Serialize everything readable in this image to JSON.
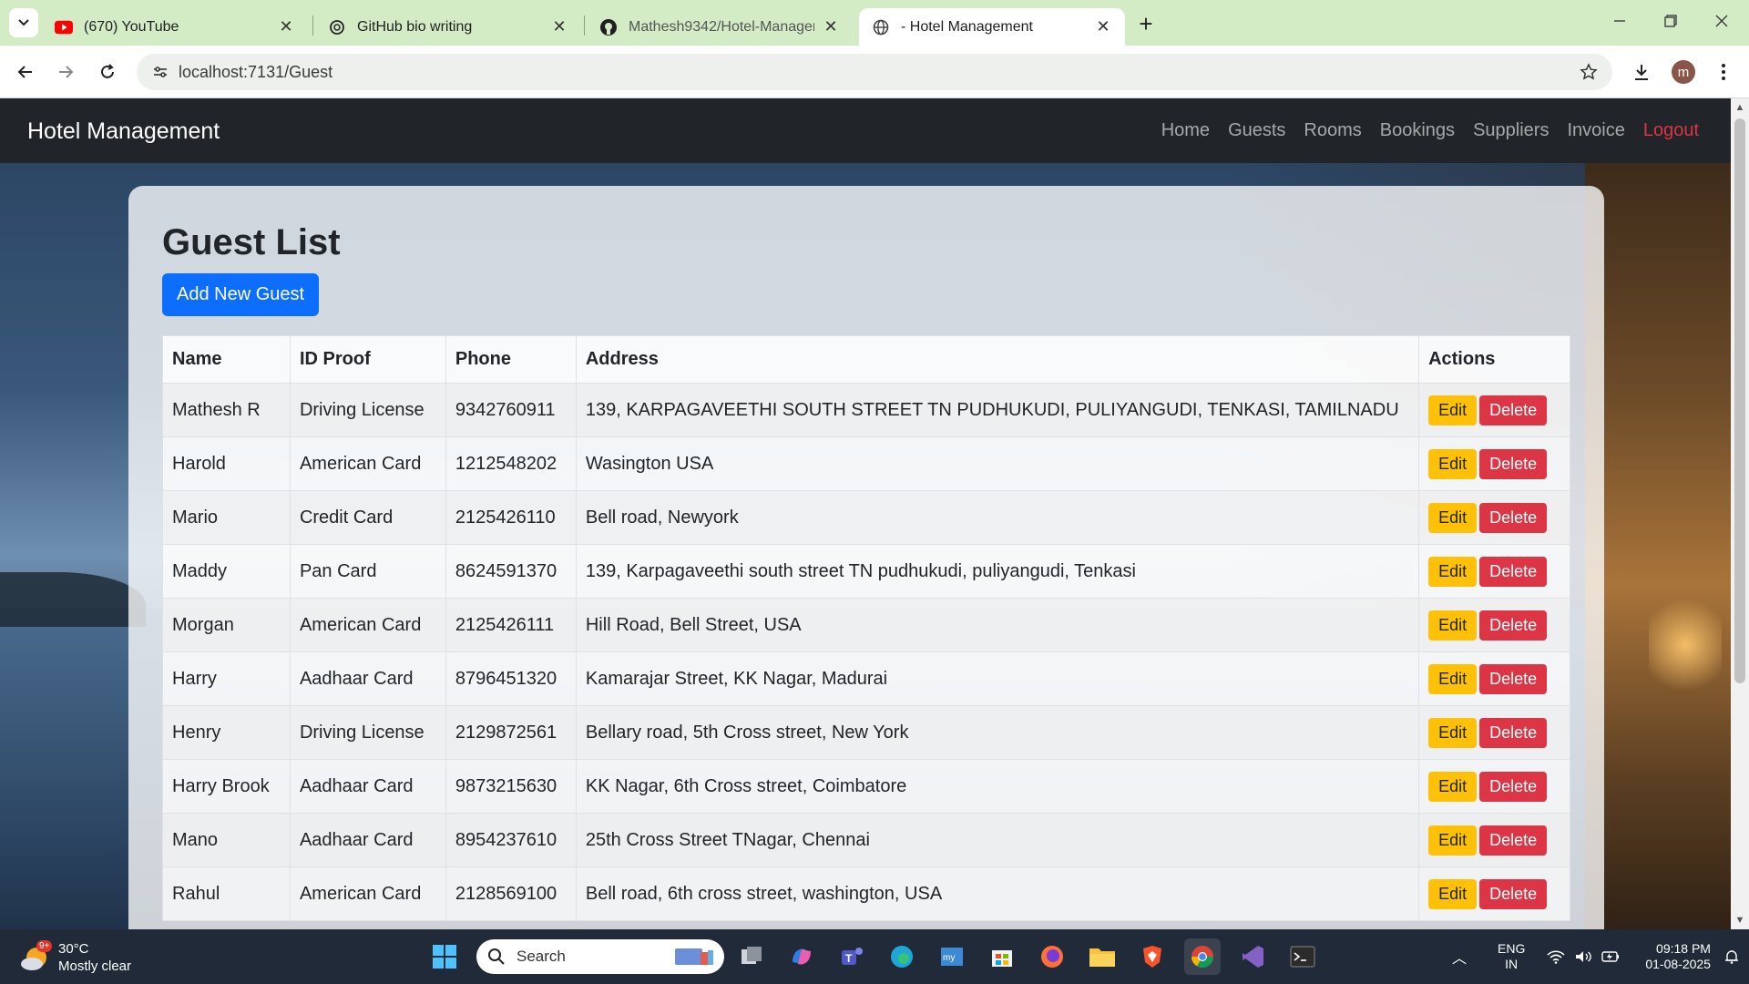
{
  "browser": {
    "tabs": [
      {
        "title": "(670) YouTube",
        "icon": "youtube-icon",
        "active": false
      },
      {
        "title": "GitHub bio writing",
        "icon": "chatgpt-icon",
        "active": false
      },
      {
        "title": "Mathesh9342/Hotel-Management",
        "icon": "github-icon",
        "active": false
      },
      {
        "title": "- Hotel Management",
        "icon": "globe-icon",
        "active": true
      }
    ],
    "url": "localhost:7131/Guest",
    "profile_initial": "m"
  },
  "app": {
    "brand": "Hotel Management",
    "nav": [
      "Home",
      "Guests",
      "Rooms",
      "Bookings",
      "Suppliers",
      "Invoice"
    ],
    "logout": "Logout"
  },
  "page": {
    "title": "Guest List",
    "add_button": "Add New Guest",
    "columns": [
      "Name",
      "ID Proof",
      "Phone",
      "Address",
      "Actions"
    ],
    "edit_label": "Edit",
    "delete_label": "Delete",
    "rows": [
      {
        "name": "Mathesh R",
        "id_proof": "Driving License",
        "phone": "9342760911",
        "address": "139, KARPAGAVEETHI SOUTH STREET TN PUDHUKUDI, PULIYANGUDI, TENKASI, TAMILNADU"
      },
      {
        "name": "Harold",
        "id_proof": "American Card",
        "phone": "1212548202",
        "address": "Wasington USA"
      },
      {
        "name": "Mario",
        "id_proof": "Credit Card",
        "phone": "2125426110",
        "address": "Bell road, Newyork"
      },
      {
        "name": "Maddy",
        "id_proof": "Pan Card",
        "phone": "8624591370",
        "address": "139, Karpagaveethi south street TN pudhukudi, puliyangudi, Tenkasi"
      },
      {
        "name": "Morgan",
        "id_proof": "American Card",
        "phone": "2125426111",
        "address": "Hill Road, Bell Street, USA"
      },
      {
        "name": "Harry",
        "id_proof": "Aadhaar Card",
        "phone": "8796451320",
        "address": "Kamarajar Street, KK Nagar, Madurai"
      },
      {
        "name": "Henry",
        "id_proof": "Driving License",
        "phone": "2129872561",
        "address": "Bellary road, 5th Cross street, New York"
      },
      {
        "name": "Harry Brook",
        "id_proof": "Aadhaar Card",
        "phone": "9873215630",
        "address": "KK Nagar, 6th Cross street, Coimbatore"
      },
      {
        "name": "Mano",
        "id_proof": "Aadhaar Card",
        "phone": "8954237610",
        "address": "25th Cross Street TNagar, Chennai"
      },
      {
        "name": "Rahul",
        "id_proof": "American Card",
        "phone": "2128569100",
        "address": "Bell road, 6th cross street, washington, USA"
      }
    ]
  },
  "taskbar": {
    "weather_badge": "9+",
    "temperature": "30°C",
    "condition": "Mostly clear",
    "search_label": "Search",
    "lang_line1": "ENG",
    "lang_line2": "IN",
    "time": "09:18 PM",
    "date": "01-08-2025"
  },
  "colors": {
    "primary": "#0d6efd",
    "warning": "#ffc107",
    "danger": "#dc3545",
    "navbar": "#212529",
    "tabstrip": "#d3ecc6"
  }
}
